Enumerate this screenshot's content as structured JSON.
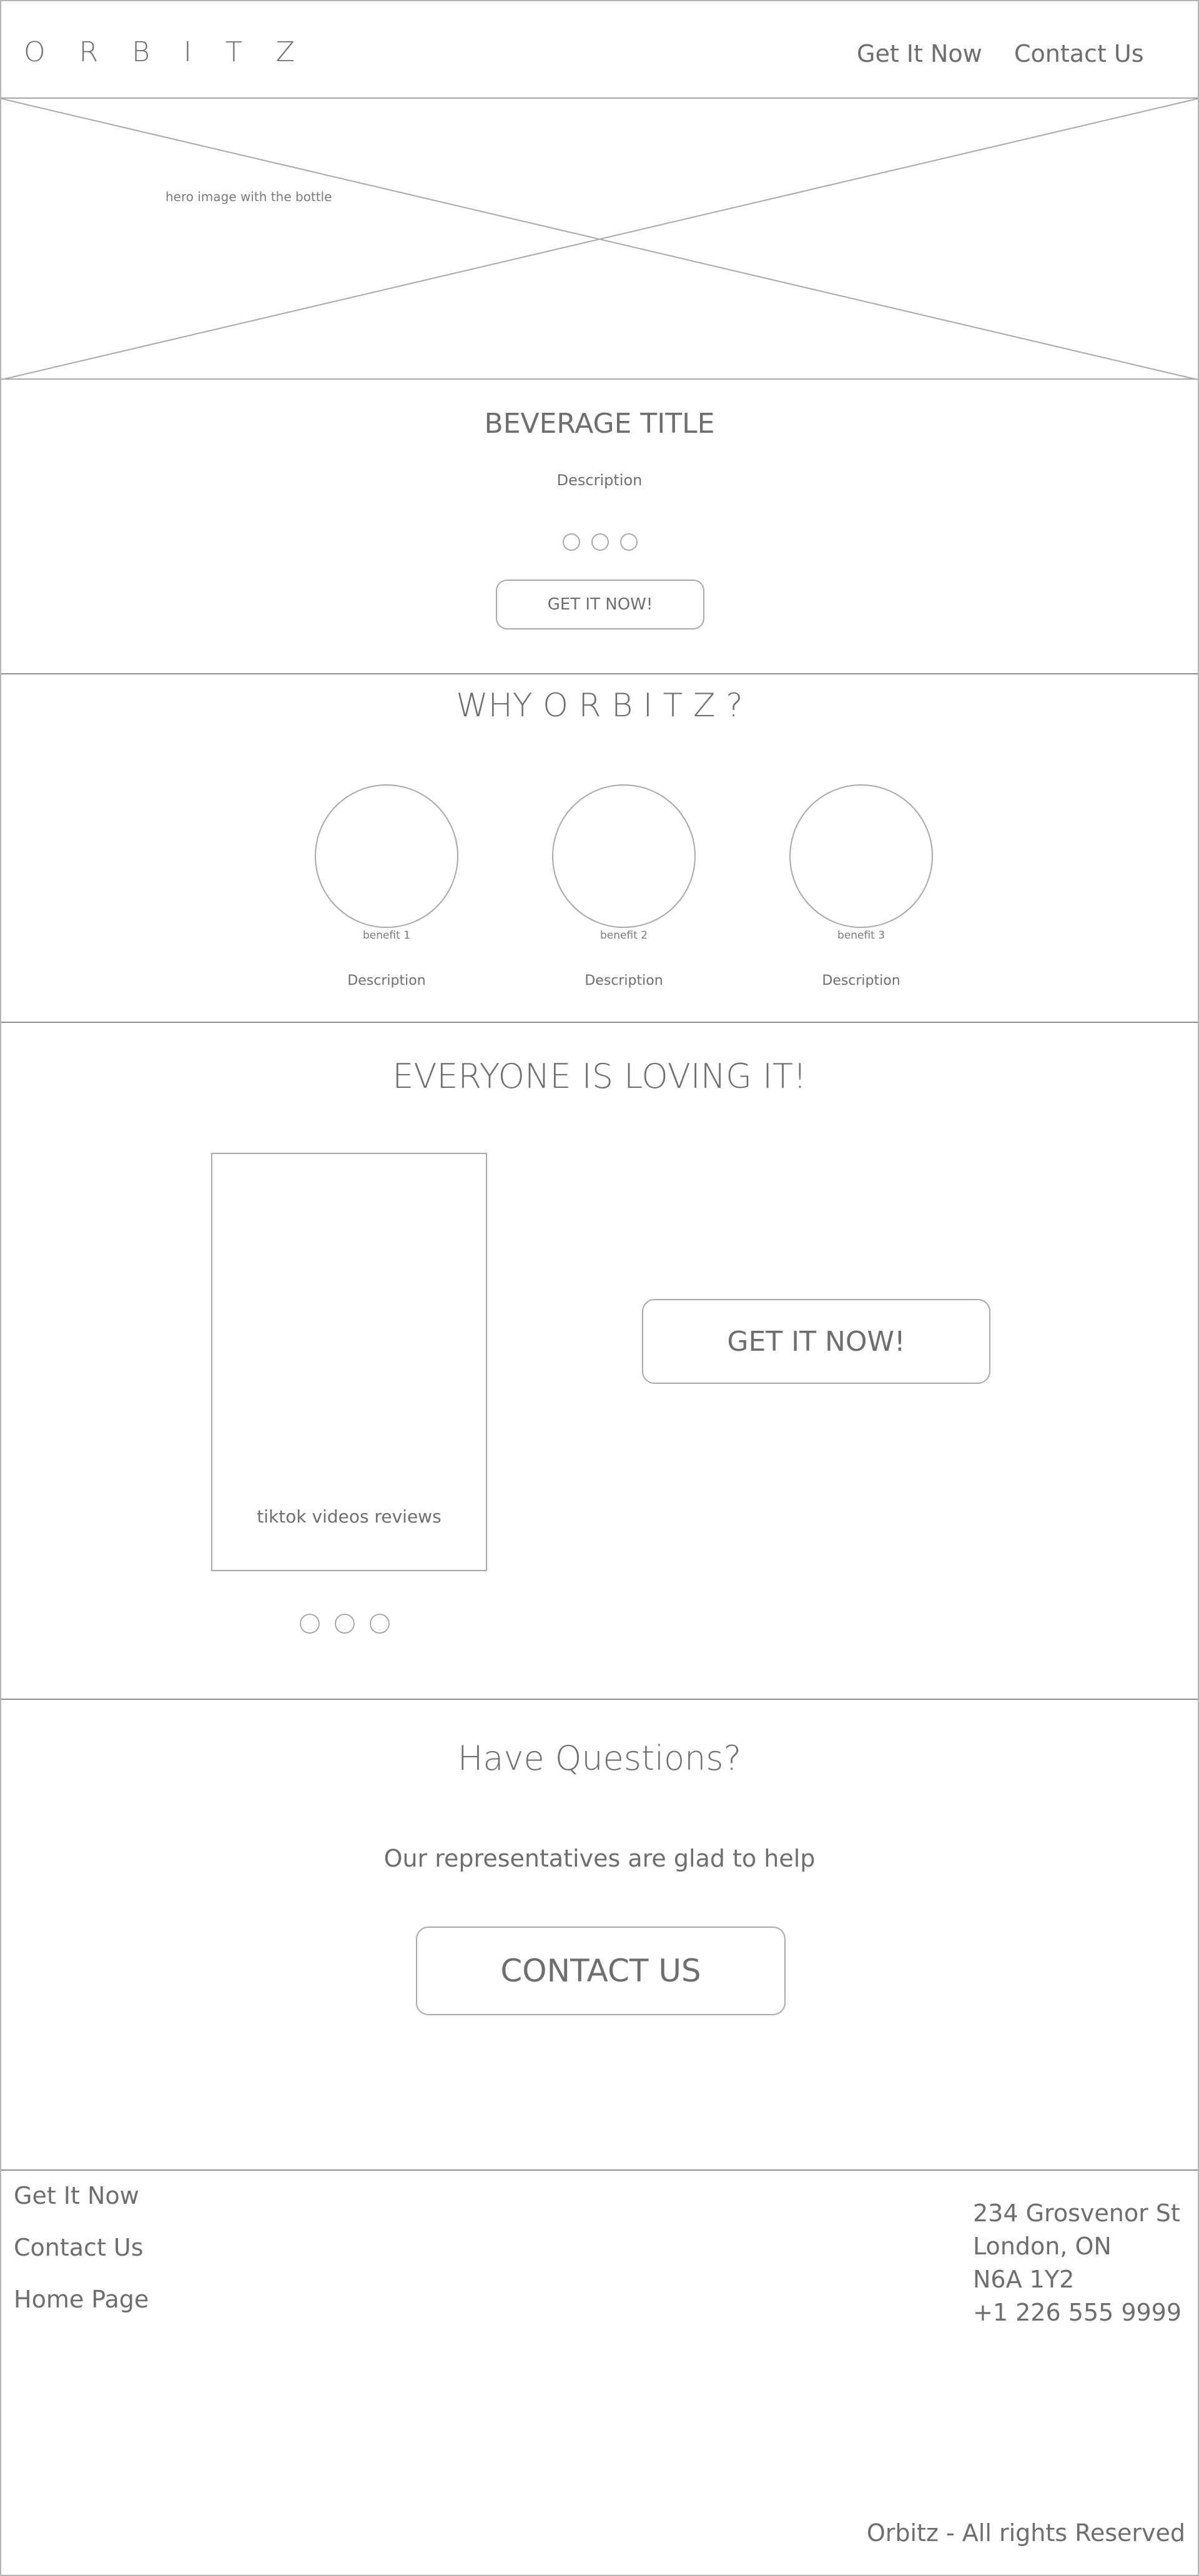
{
  "header": {
    "logo": "O R B I T Z",
    "nav": {
      "get_it_now": "Get It Now",
      "contact_us": "Contact Us"
    }
  },
  "hero": {
    "caption": "hero image with the bottle"
  },
  "product": {
    "title": "BEVERAGE TITLE",
    "description": "Description",
    "button": "GET IT NOW!"
  },
  "why": {
    "title": "WHY O R B I T Z ?",
    "benefits": [
      {
        "label": "benefit 1",
        "description": "Description"
      },
      {
        "label": "benefit 2",
        "description": "Description"
      },
      {
        "label": "benefit 3",
        "description": "Description"
      }
    ]
  },
  "loving": {
    "title": "EVERYONE IS LOVING IT!",
    "video_caption": "tiktok videos reviews",
    "button": "GET IT NOW!"
  },
  "questions": {
    "title": "Have Questions?",
    "subtitle": "Our representatives are glad to help",
    "button": "CONTACT US"
  },
  "footer": {
    "links": [
      "Get It Now",
      "Contact Us",
      "Home Page"
    ],
    "address": [
      "234 Grosvenor St",
      "London, ON",
      "N6A 1Y2",
      "+1 226 555 9999"
    ],
    "copyright": "Orbitz - All rights Reserved"
  }
}
